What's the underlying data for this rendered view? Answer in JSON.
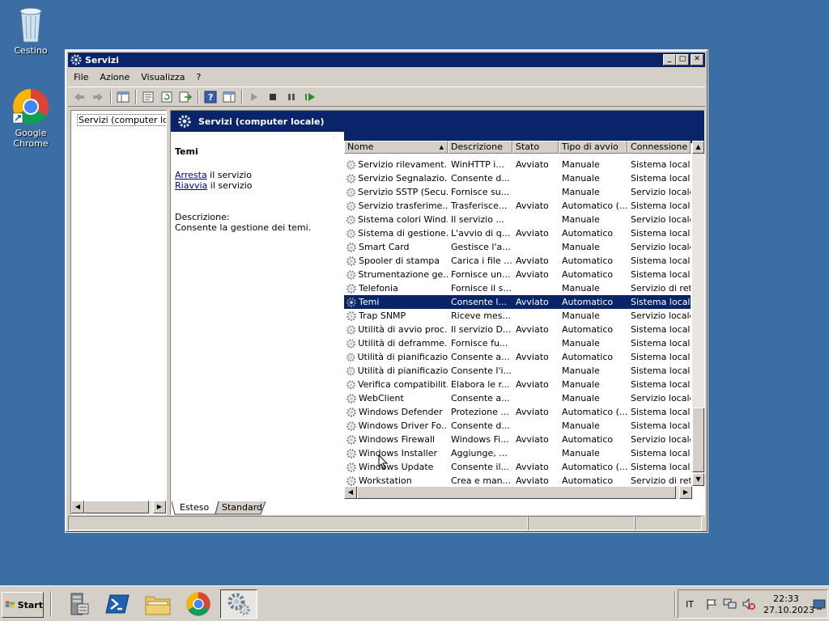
{
  "desktop": {
    "icons": [
      {
        "label": "Cestino",
        "icon": "recycle-bin-icon"
      },
      {
        "label": "Google Chrome",
        "icon": "chrome-icon"
      }
    ]
  },
  "window": {
    "title": "Servizi",
    "menu": [
      "File",
      "Azione",
      "Visualizza",
      "?"
    ],
    "tree_item": "Servizi (computer lo",
    "header": "Servizi (computer locale)",
    "selected_service": "Temi",
    "action_stop": "Arresta",
    "action_restart": "Riavvia",
    "action_suffix": " il servizio",
    "desc_label": "Descrizione:",
    "desc_text": "Consente la gestione dei temi.",
    "columns": [
      "Nome",
      "Descrizione",
      "Stato",
      "Tipo di avvio",
      "Connessione"
    ],
    "rows": [
      [
        "Servizio rilevament...",
        "WinHTTP i...",
        "Avviato",
        "Manuale",
        "Sistema locale"
      ],
      [
        "Servizio Segnalazio...",
        "Consente d...",
        "",
        "Manuale",
        "Sistema locale"
      ],
      [
        "Servizio SSTP (Secu...",
        "Fornisce su...",
        "",
        "Manuale",
        "Servizio locale"
      ],
      [
        "Servizio trasferime...",
        "Trasferisce...",
        "Avviato",
        "Automatico (...",
        "Sistema locale"
      ],
      [
        "Sistema colori Wind...",
        "Il servizio ...",
        "",
        "Manuale",
        "Servizio locale"
      ],
      [
        "Sistema di gestione...",
        "L'avvio di q...",
        "Avviato",
        "Automatico",
        "Sistema locale"
      ],
      [
        "Smart Card",
        "Gestisce l'a...",
        "",
        "Manuale",
        "Servizio locale"
      ],
      [
        "Spooler di stampa",
        "Carica i file ...",
        "Avviato",
        "Automatico",
        "Sistema locale"
      ],
      [
        "Strumentazione ge...",
        "Fornisce un...",
        "Avviato",
        "Automatico",
        "Sistema locale"
      ],
      [
        "Telefonia",
        "Fornisce il s...",
        "",
        "Manuale",
        "Servizio di rete"
      ],
      [
        "Temi",
        "Consente l...",
        "Avviato",
        "Automatico",
        "Sistema locale"
      ],
      [
        "Trap SNMP",
        "Riceve mes...",
        "",
        "Manuale",
        "Servizio locale"
      ],
      [
        "Utilità di avvio proc...",
        "Il servizio D...",
        "Avviato",
        "Automatico",
        "Sistema locale"
      ],
      [
        "Utilità di deframme...",
        "Fornisce fu...",
        "",
        "Manuale",
        "Sistema locale"
      ],
      [
        "Utilità di pianificazione",
        "Consente a...",
        "Avviato",
        "Automatico",
        "Sistema locale"
      ],
      [
        "Utilità di pianificazio...",
        "Consente l'i...",
        "",
        "Manuale",
        "Sistema locale"
      ],
      [
        "Verifica compatibilit...",
        "Elabora le r...",
        "Avviato",
        "Manuale",
        "Sistema locale"
      ],
      [
        "WebClient",
        "Consente a...",
        "",
        "Manuale",
        "Servizio locale"
      ],
      [
        "Windows Defender",
        "Protezione ...",
        "Avviato",
        "Automatico (...",
        "Sistema locale"
      ],
      [
        "Windows Driver Fo...",
        "Consente d...",
        "",
        "Manuale",
        "Sistema locale"
      ],
      [
        "Windows Firewall",
        "Windows Fi...",
        "Avviato",
        "Automatico",
        "Servizio locale"
      ],
      [
        "Windows Installer",
        "Aggiunge, ...",
        "",
        "Manuale",
        "Sistema locale"
      ],
      [
        "Windows Update",
        "Consente il...",
        "Avviato",
        "Automatico (...",
        "Sistema locale"
      ],
      [
        "Workstation",
        "Crea e man...",
        "Avviato",
        "Automatico",
        "Servizio di rete"
      ]
    ],
    "selected_row_index": 10,
    "tabs": [
      "Esteso",
      "Standard"
    ]
  },
  "taskbar": {
    "start_label": "Start",
    "apps": [
      "server-manager-icon",
      "powershell-icon",
      "explorer-icon",
      "chrome-icon",
      "services-icon"
    ],
    "language": "IT",
    "time": "22:33",
    "date": "27.10.2023"
  },
  "colors": {
    "desktop": "#3a6ea5",
    "titlebar": "#0a246a",
    "selection": "#0a246a",
    "chrome": "#d4d0c8"
  }
}
